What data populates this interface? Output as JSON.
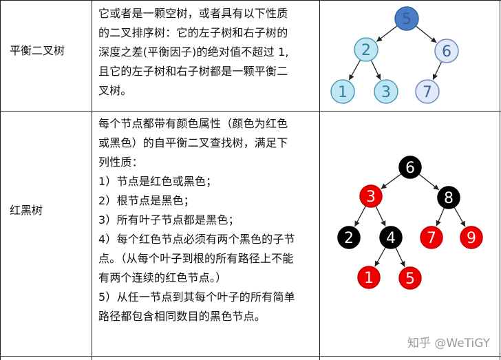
{
  "rows": [
    {
      "label": "平衡二叉树",
      "description": [
        "它或者是一颗空树，或者具有以下性质",
        "的二叉排序树：它的左子树和右子树的",
        "深度之差(平衡因子)的绝对值不超过 1,",
        "且它的左子树和右子树都是一颗平衡二",
        "叉树。"
      ],
      "tree": {
        "nodes": [
          {
            "id": "5",
            "label": "5",
            "fill": "#4a7dc4",
            "stroke": "#2f5f9e",
            "text": "#2f5f9e"
          },
          {
            "id": "2",
            "label": "2",
            "fill": "#bfe6f2",
            "stroke": "#4a9bbd",
            "text": "#2f7fa0"
          },
          {
            "id": "6",
            "label": "6",
            "fill": "#dfe9f7",
            "stroke": "#6b87b8",
            "text": "#3d5f9a"
          },
          {
            "id": "1",
            "label": "1",
            "fill": "#bfe6f2",
            "stroke": "#4a9bbd",
            "text": "#2f7fa0"
          },
          {
            "id": "3",
            "label": "3",
            "fill": "#bfe6f2",
            "stroke": "#4a9bbd",
            "text": "#2f7fa0"
          },
          {
            "id": "7",
            "label": "7",
            "fill": "#dfe9f7",
            "stroke": "#6b87b8",
            "text": "#3d5f9a"
          }
        ],
        "edges": [
          [
            "5",
            "2"
          ],
          [
            "5",
            "6"
          ],
          [
            "2",
            "1"
          ],
          [
            "2",
            "3"
          ],
          [
            "6",
            "7"
          ]
        ]
      }
    },
    {
      "label": "红黑树",
      "description": [
        "每个节点都带有颜色属性（颜色为红色",
        "或黑色）的自平衡二叉查找树，满足下",
        "列性质：",
        "1）节点是红色或黑色；",
        "2）根节点是黑色；",
        "3）所有叶子节点都是黑色；",
        "4）每个红色节点必须有两个黑色的子节",
        "点。（从每个叶子到根的所有路径上不能",
        "有两个连续的红色节点。）",
        "5）从任一节点到其每个叶子的所有简单",
        "路径都包含相同数目的黑色节点。"
      ],
      "tree": {
        "nodes": [
          {
            "id": "6",
            "label": "6",
            "fill": "#000000",
            "stroke": "#000000",
            "text": "#ffffff"
          },
          {
            "id": "3",
            "label": "3",
            "fill": "#ee0000",
            "stroke": "#c00000",
            "text": "#ffffff"
          },
          {
            "id": "8",
            "label": "8",
            "fill": "#000000",
            "stroke": "#000000",
            "text": "#ffffff"
          },
          {
            "id": "2",
            "label": "2",
            "fill": "#000000",
            "stroke": "#000000",
            "text": "#ffffff"
          },
          {
            "id": "4",
            "label": "4",
            "fill": "#000000",
            "stroke": "#000000",
            "text": "#ffffff"
          },
          {
            "id": "7",
            "label": "7",
            "fill": "#ee0000",
            "stroke": "#c00000",
            "text": "#ffffff"
          },
          {
            "id": "9",
            "label": "9",
            "fill": "#ee0000",
            "stroke": "#c00000",
            "text": "#ffffff"
          },
          {
            "id": "1",
            "label": "1",
            "fill": "#ee0000",
            "stroke": "#c00000",
            "text": "#ffffff"
          },
          {
            "id": "5",
            "label": "5",
            "fill": "#ee0000",
            "stroke": "#c00000",
            "text": "#ffffff"
          }
        ],
        "edges": [
          [
            "6",
            "3"
          ],
          [
            "6",
            "8"
          ],
          [
            "3",
            "2"
          ],
          [
            "3",
            "4"
          ],
          [
            "8",
            "7"
          ],
          [
            "8",
            "9"
          ],
          [
            "4",
            "1"
          ],
          [
            "4",
            "5"
          ]
        ]
      }
    }
  ],
  "watermark": "知乎 @WeTiGY"
}
